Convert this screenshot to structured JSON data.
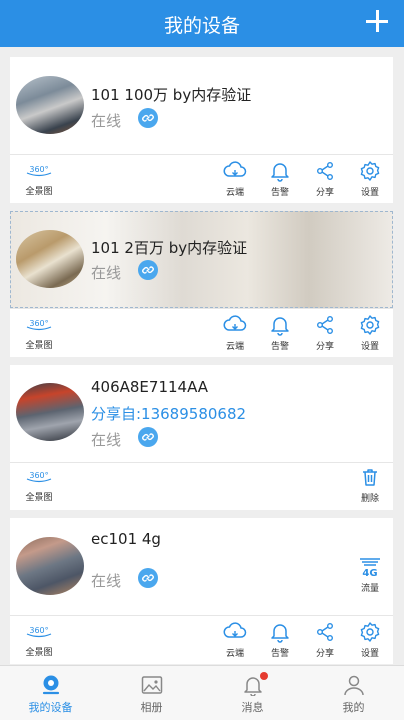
{
  "header": {
    "title": "我的设备",
    "add_label": "+"
  },
  "devices": [
    {
      "name": "101 100万 by内存验证",
      "status": "在线",
      "actions": [
        "云端",
        "告警",
        "分享",
        "设置"
      ]
    },
    {
      "name": "101 2百万 by内存验证",
      "status": "在线",
      "actions": [
        "云端",
        "告警",
        "分享",
        "设置"
      ]
    },
    {
      "name": "406A8E7114AA",
      "shared_from": "分享自:13689580682",
      "status": "在线",
      "actions": [
        "删除"
      ]
    },
    {
      "name": "ec101 4g",
      "status": "在线",
      "side_action": "流量",
      "actions": [
        "云端",
        "告警",
        "分享",
        "设置"
      ]
    }
  ],
  "panorama_label": "全景图",
  "panorama_badge": "360°",
  "fourg_badge": "4G",
  "tabs": [
    {
      "label": "我的设备",
      "active": true
    },
    {
      "label": "相册"
    },
    {
      "label": "消息",
      "has_badge": true
    },
    {
      "label": "我的"
    }
  ],
  "colors": {
    "accent": "#2b8fe5",
    "badge": "#e53b2f",
    "link": "#4aa7ee"
  }
}
